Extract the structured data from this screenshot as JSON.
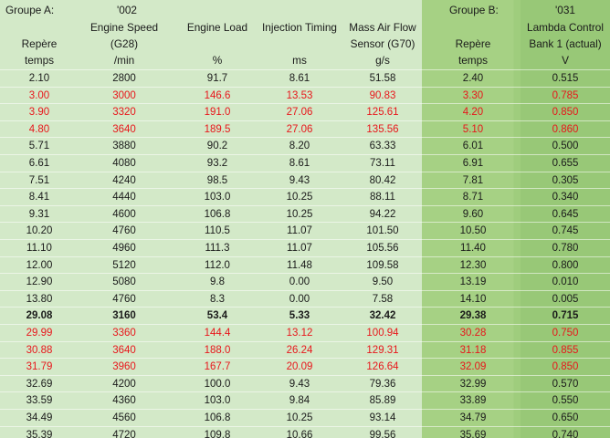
{
  "header": {
    "row1": {
      "groupA": "Groupe A:",
      "code002": "'002",
      "groupB": "Groupe B:",
      "code031": "'031"
    },
    "row2": {
      "engine_speed": "Engine Speed",
      "engine_load": "Engine Load",
      "injection_timing": "Injection Timing",
      "mass_air_flow": "Mass Air Flow",
      "lambda_control": "Lambda Control"
    },
    "row3": {
      "repere_a": "Repère",
      "g28": "(G28)",
      "sensor_g70": "Sensor (G70)",
      "repere_b": "Repère",
      "bank1": "Bank 1 (actual)"
    },
    "row4": {
      "temps_a": "temps",
      "per_min": "/min",
      "percent": "%",
      "ms": "ms",
      "gs": "g/s",
      "temps_b": "temps",
      "volt": "V"
    }
  },
  "rows": [
    {
      "style": "normal",
      "cells": [
        "2.10",
        "2800",
        "91.7",
        "8.61",
        "51.58",
        "2.40",
        "0.515"
      ]
    },
    {
      "style": "red",
      "cells": [
        "3.00",
        "3000",
        "146.6",
        "13.53",
        "90.83",
        "3.30",
        "0.785"
      ]
    },
    {
      "style": "red",
      "cells": [
        "3.90",
        "3320",
        "191.0",
        "27.06",
        "125.61",
        "4.20",
        "0.850"
      ]
    },
    {
      "style": "red",
      "cells": [
        "4.80",
        "3640",
        "189.5",
        "27.06",
        "135.56",
        "5.10",
        "0.860"
      ]
    },
    {
      "style": "normal",
      "cells": [
        "5.71",
        "3880",
        "90.2",
        "8.20",
        "63.33",
        "6.01",
        "0.500"
      ]
    },
    {
      "style": "normal",
      "cells": [
        "6.61",
        "4080",
        "93.2",
        "8.61",
        "73.11",
        "6.91",
        "0.655"
      ]
    },
    {
      "style": "normal",
      "cells": [
        "7.51",
        "4240",
        "98.5",
        "9.43",
        "80.42",
        "7.81",
        "0.305"
      ]
    },
    {
      "style": "normal",
      "cells": [
        "8.41",
        "4440",
        "103.0",
        "10.25",
        "88.11",
        "8.71",
        "0.340"
      ]
    },
    {
      "style": "normal",
      "cells": [
        "9.31",
        "4600",
        "106.8",
        "10.25",
        "94.22",
        "9.60",
        "0.645"
      ]
    },
    {
      "style": "normal",
      "cells": [
        "10.20",
        "4760",
        "110.5",
        "11.07",
        "101.50",
        "10.50",
        "0.745"
      ]
    },
    {
      "style": "normal",
      "cells": [
        "11.10",
        "4960",
        "111.3",
        "11.07",
        "105.56",
        "11.40",
        "0.780"
      ]
    },
    {
      "style": "normal",
      "cells": [
        "12.00",
        "5120",
        "112.0",
        "11.48",
        "109.58",
        "12.30",
        "0.800"
      ]
    },
    {
      "style": "normal",
      "cells": [
        "12.90",
        "5080",
        "9.8",
        "0.00",
        "9.50",
        "13.19",
        "0.010"
      ]
    },
    {
      "style": "normal",
      "cells": [
        "13.80",
        "4760",
        "8.3",
        "0.00",
        "7.58",
        "14.10",
        "0.005"
      ]
    },
    {
      "style": "bold",
      "cells": [
        "29.08",
        "3160",
        "53.4",
        "5.33",
        "32.42",
        "29.38",
        "0.715"
      ]
    },
    {
      "style": "red",
      "cells": [
        "29.99",
        "3360",
        "144.4",
        "13.12",
        "100.94",
        "30.28",
        "0.750"
      ]
    },
    {
      "style": "red",
      "cells": [
        "30.88",
        "3640",
        "188.0",
        "26.24",
        "129.31",
        "31.18",
        "0.855"
      ]
    },
    {
      "style": "red",
      "cells": [
        "31.79",
        "3960",
        "167.7",
        "20.09",
        "126.64",
        "32.09",
        "0.850"
      ]
    },
    {
      "style": "normal",
      "cells": [
        "32.69",
        "4200",
        "100.0",
        "9.43",
        "79.36",
        "32.99",
        "0.570"
      ]
    },
    {
      "style": "normal",
      "cells": [
        "33.59",
        "4360",
        "103.0",
        "9.84",
        "85.89",
        "33.89",
        "0.550"
      ]
    },
    {
      "style": "normal",
      "cells": [
        "34.49",
        "4560",
        "106.8",
        "10.25",
        "93.14",
        "34.79",
        "0.650"
      ]
    },
    {
      "style": "normal",
      "cells": [
        "35.39",
        "4720",
        "109.8",
        "10.66",
        "99.56",
        "35.69",
        "0.740"
      ]
    }
  ],
  "colors": {
    "red_text": "#e8161b",
    "group_a_bg": "#d3e9c8",
    "group_b_bg": "#a6d184"
  }
}
